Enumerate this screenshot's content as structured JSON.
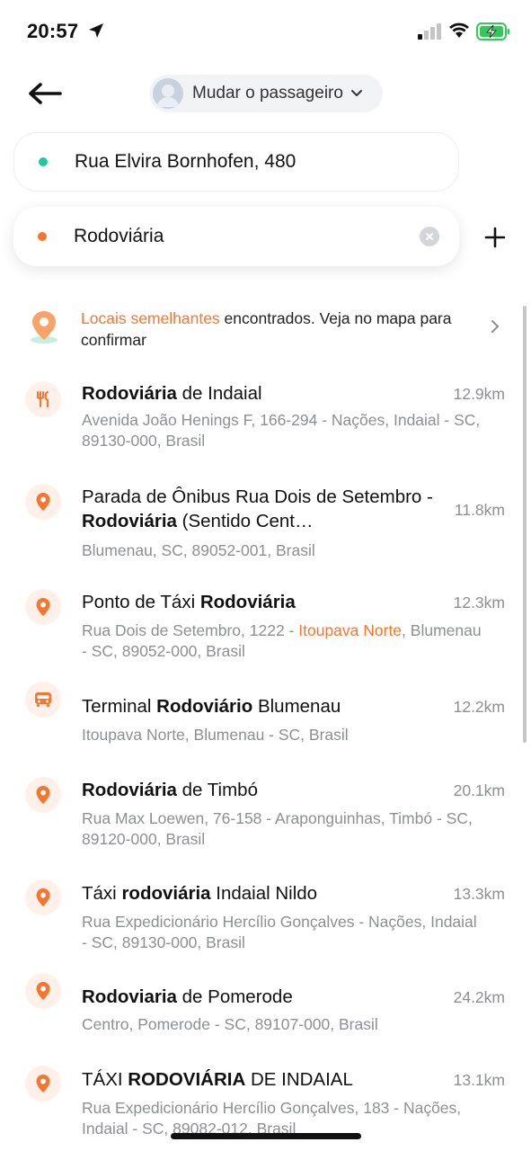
{
  "status_bar": {
    "time": "20:57",
    "icons": [
      "location-arrow-icon",
      "signal-icon",
      "wifi-icon",
      "battery-charging-icon"
    ],
    "battery_color": "#34c759"
  },
  "header": {
    "back_icon": "arrow-left-icon",
    "passenger_label": "Mudar o passageiro",
    "passenger_chevron": "chevron-down-icon"
  },
  "route": {
    "origin": {
      "value": "Rua Elvira Bornhofen, 480",
      "dot_color": "#1fc9a2"
    },
    "destination": {
      "value": "Rodoviária",
      "dot_color": "#f7762f"
    },
    "clear_icon": "clear-icon",
    "add_stop_icon": "plus-icon"
  },
  "similar_places": {
    "icon": "map-pin-icon",
    "highlight": "Locais semelhantes",
    "text_rest": " encontrados. Veja no mapa para confirmar",
    "chevron": "chevron-right-icon"
  },
  "accent_color": "#f7762f",
  "results": [
    {
      "icon": "restaurant-icon",
      "title": [
        {
          "t": "Rodoviária",
          "b": true
        },
        {
          "t": " de Indaial",
          "b": false
        }
      ],
      "address": [
        {
          "t": "Avenida João Henings F, 166-294 - Nações, Indaial - SC, 89130-000, Brasil",
          "hl": false
        }
      ],
      "distance": "12.9km"
    },
    {
      "icon": "location-pin-icon",
      "title": [
        {
          "t": "Parada de Ônibus Rua Dois de Setembro - ",
          "b": false
        },
        {
          "t": "Rodoviária",
          "b": true
        },
        {
          "t": " (Sentido Cent…",
          "b": false
        }
      ],
      "address": [
        {
          "t": "Blumenau, SC, 89052-001, Brasil",
          "hl": false
        }
      ],
      "distance": "11.8km"
    },
    {
      "icon": "location-pin-icon",
      "title": [
        {
          "t": "Ponto de Táxi ",
          "b": false
        },
        {
          "t": "Rodoviária",
          "b": true
        }
      ],
      "address": [
        {
          "t": "Rua Dois de Setembro, 1222 - ",
          "hl": false
        },
        {
          "t": "Itoupava Norte",
          "hl": true
        },
        {
          "t": ", Blumenau - SC, 89052-000, Brasil",
          "hl": false
        }
      ],
      "distance": "12.3km"
    },
    {
      "icon": "bus-icon",
      "title": [
        {
          "t": "Terminal ",
          "b": false
        },
        {
          "t": "Rodoviário",
          "b": true
        },
        {
          "t": " Blumenau",
          "b": false
        }
      ],
      "address": [
        {
          "t": "Itoupava Norte, Blumenau - SC, Brasil",
          "hl": false
        }
      ],
      "distance": "12.2km"
    },
    {
      "icon": "location-pin-icon",
      "title": [
        {
          "t": "Rodoviária",
          "b": true
        },
        {
          "t": " de Timbó",
          "b": false
        }
      ],
      "address": [
        {
          "t": "Rua Max Loewen, 76-158 - Araponguinhas, Timbó - SC, 89120-000, Brasil",
          "hl": false
        }
      ],
      "distance": "20.1km"
    },
    {
      "icon": "location-pin-icon",
      "title": [
        {
          "t": "Táxi ",
          "b": false
        },
        {
          "t": "rodoviária",
          "b": true
        },
        {
          "t": " Indaial Nildo",
          "b": false
        }
      ],
      "address": [
        {
          "t": "Rua Expedicionário Hercílio Gonçalves - Nações, Indaial - SC, 89130-000, Brasil",
          "hl": false
        }
      ],
      "distance": "13.3km"
    },
    {
      "icon": "location-pin-icon",
      "title": [
        {
          "t": "Rodoviaria",
          "b": true
        },
        {
          "t": " de Pomerode",
          "b": false
        }
      ],
      "address": [
        {
          "t": "Centro, Pomerode - SC, 89107-000, Brasil",
          "hl": false
        }
      ],
      "distance": "24.2km"
    },
    {
      "icon": "location-pin-icon",
      "title": [
        {
          "t": "TÁXI ",
          "b": false
        },
        {
          "t": "RODOVIÁRIA",
          "b": true
        },
        {
          "t": " DE INDAIAL",
          "b": false
        }
      ],
      "address": [
        {
          "t": "Rua Expedicionário Hercílio Gonçalves, 183 - Nações, Indaial - SC, 89082-012, Brasil",
          "hl": false
        }
      ],
      "distance": "13.1km"
    }
  ]
}
